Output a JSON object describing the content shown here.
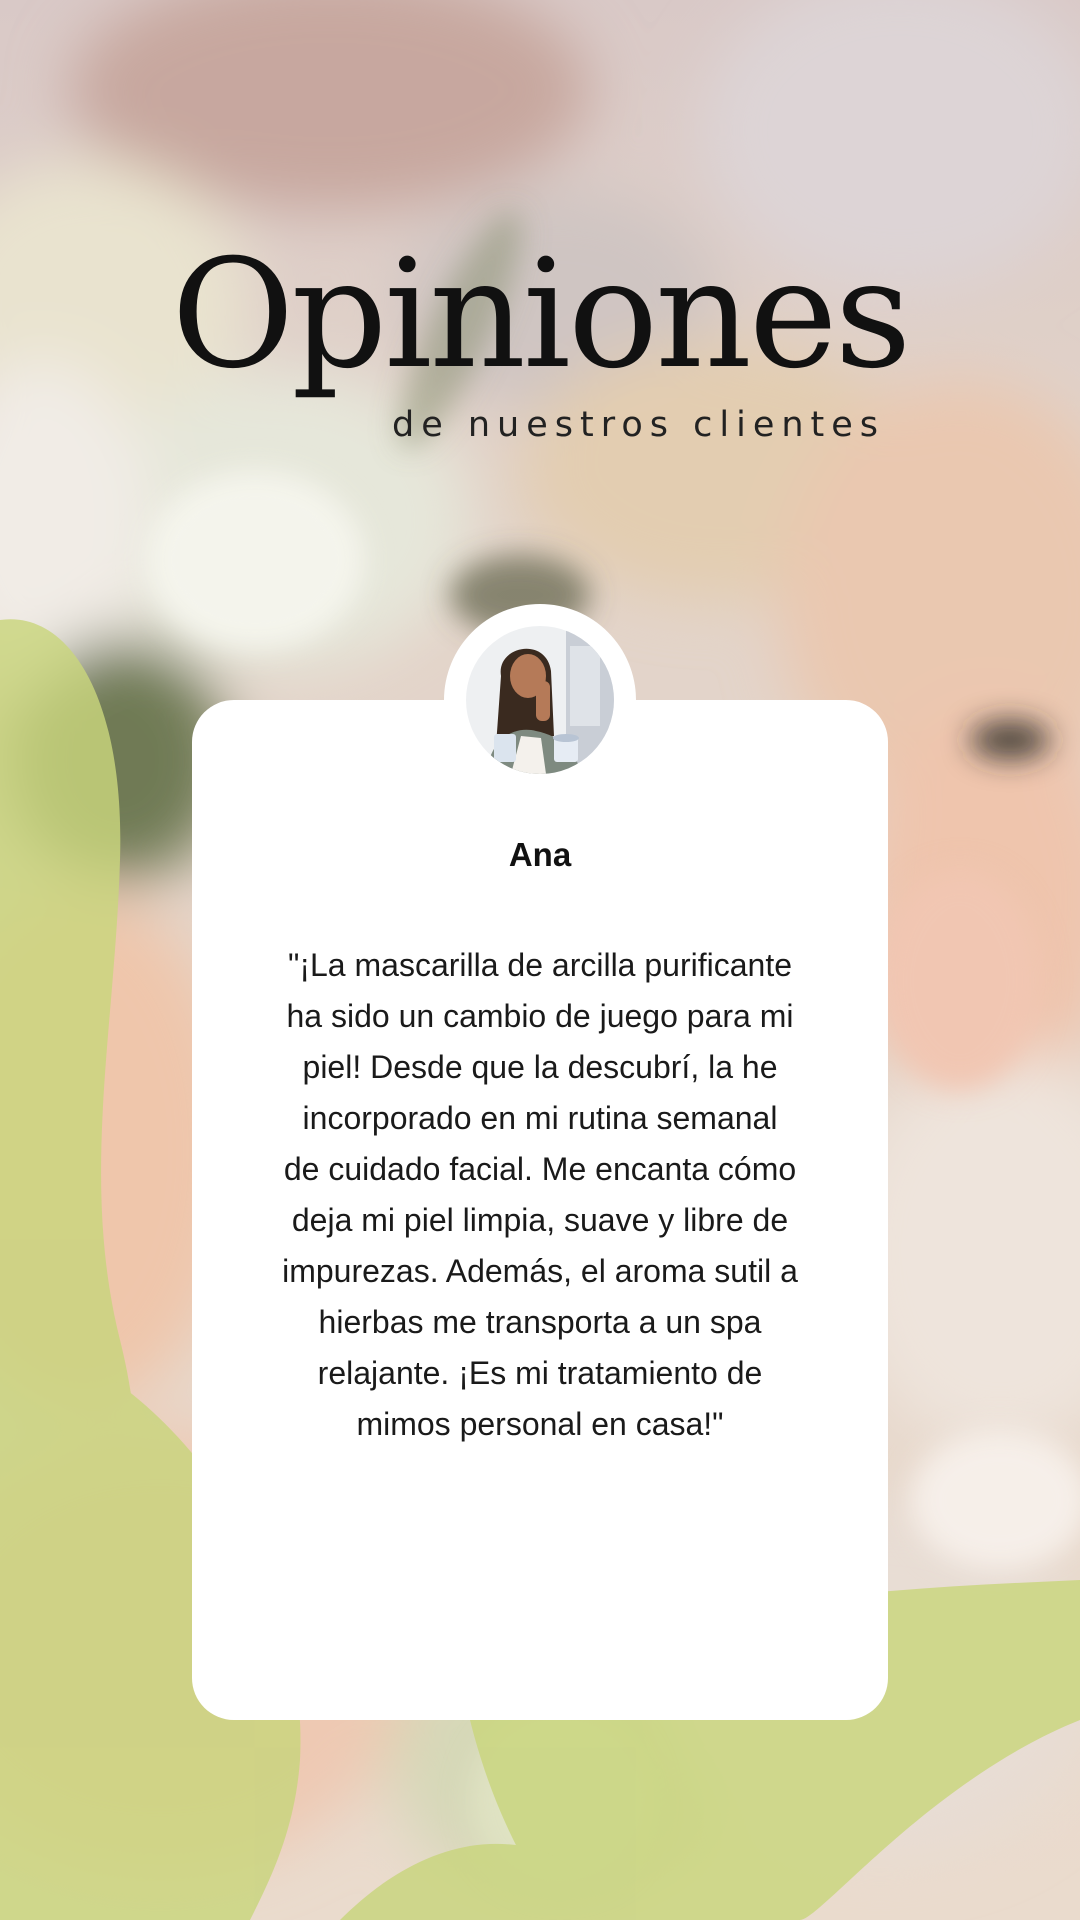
{
  "header": {
    "title": "Opiniones",
    "subtitle": "de nuestros clientes"
  },
  "testimonial": {
    "name": "Ana",
    "quote": "\"¡La mascarilla de arcilla purificante ha sido un cambio de juego para mi piel! Desde que la descubrí, la he incorporado en mi rutina semanal de cuidado facial. Me encanta cómo deja mi piel limpia, suave y libre de impurezas. Además, el aroma sutil a hierbas me transporta a un spa relajante. ¡Es mi tratamiento de mimos personal en casa!\""
  },
  "colors": {
    "accent_green": "#c6d27e",
    "card": "#ffffff",
    "text": "#111111"
  }
}
